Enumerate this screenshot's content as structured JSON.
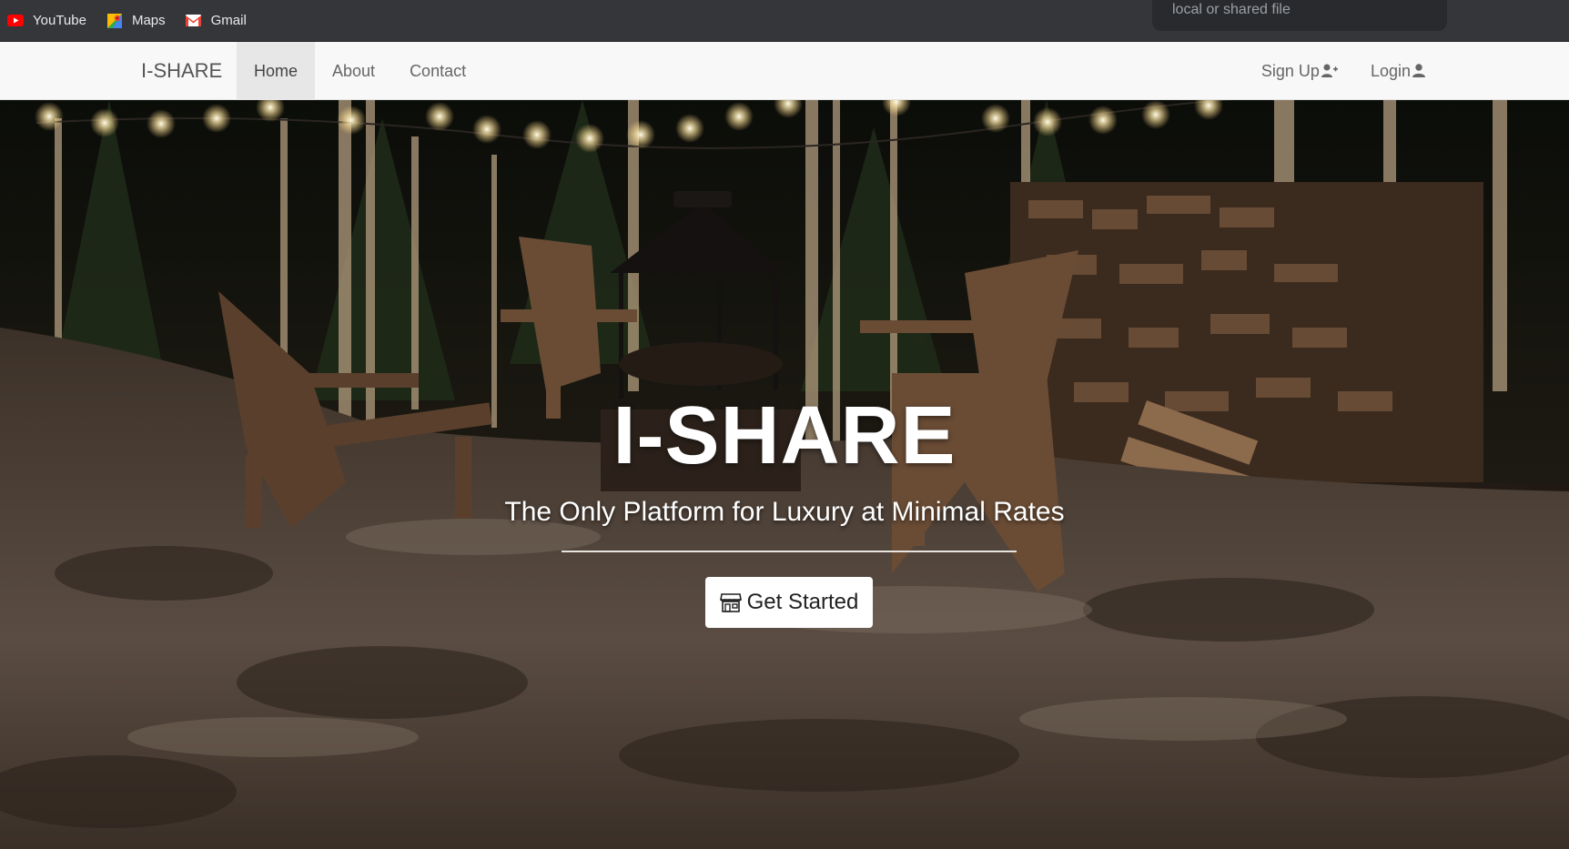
{
  "bookmarks": [
    {
      "label": "YouTube",
      "icon": "youtube-icon"
    },
    {
      "label": "Maps",
      "icon": "maps-icon"
    },
    {
      "label": "Gmail",
      "icon": "gmail-icon"
    }
  ],
  "tooltip": {
    "text": "local or shared file"
  },
  "navbar": {
    "brand": "I-SHARE",
    "links": [
      {
        "label": "Home",
        "active": true
      },
      {
        "label": "About",
        "active": false
      },
      {
        "label": "Contact",
        "active": false
      }
    ],
    "right": [
      {
        "label": "Sign Up",
        "icon": "user-plus-icon"
      },
      {
        "label": "Login",
        "icon": "user-icon"
      }
    ]
  },
  "hero": {
    "title": "I-SHARE",
    "subtitle": "The Only Platform for Luxury at Minimal Rates",
    "cta_label": "Get Started",
    "cta_icon": "store-icon"
  },
  "colors": {
    "bookmark_bar": "#35363a",
    "navbar_bg": "#f8f8f8",
    "nav_active_bg": "#e7e7e7",
    "hero_text": "#ffffff"
  }
}
